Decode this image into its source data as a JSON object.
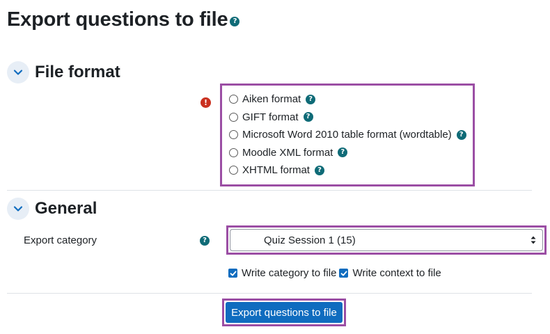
{
  "page": {
    "title": "Export questions to file"
  },
  "file_format": {
    "section_title": "File format",
    "options": [
      {
        "label": "Aiken format",
        "selected": false
      },
      {
        "label": "GIFT format",
        "selected": false
      },
      {
        "label": "Microsoft Word 2010 table format (wordtable)",
        "selected": false
      },
      {
        "label": "Moodle XML format",
        "selected": false
      },
      {
        "label": "XHTML format",
        "selected": false
      }
    ]
  },
  "general": {
    "section_title": "General",
    "export_category_label": "Export category",
    "export_category_value": "Quiz Session 1 (15)",
    "write_category_label": "Write category to file",
    "write_category_checked": true,
    "write_context_label": "Write context to file",
    "write_context_checked": true
  },
  "actions": {
    "submit_label": "Export questions to file"
  },
  "icons": {
    "help": "question-mark",
    "required": "exclamation-mark",
    "collapse": "chevron-down",
    "select": "up-down-arrows",
    "check": "check-mark"
  },
  "colors": {
    "primary": "#0f6cbf",
    "help_icon": "#0f6b77",
    "required_icon": "#ca3120",
    "highlight_border": "#9b4ea4",
    "toggle_bg": "#e7eef6"
  }
}
